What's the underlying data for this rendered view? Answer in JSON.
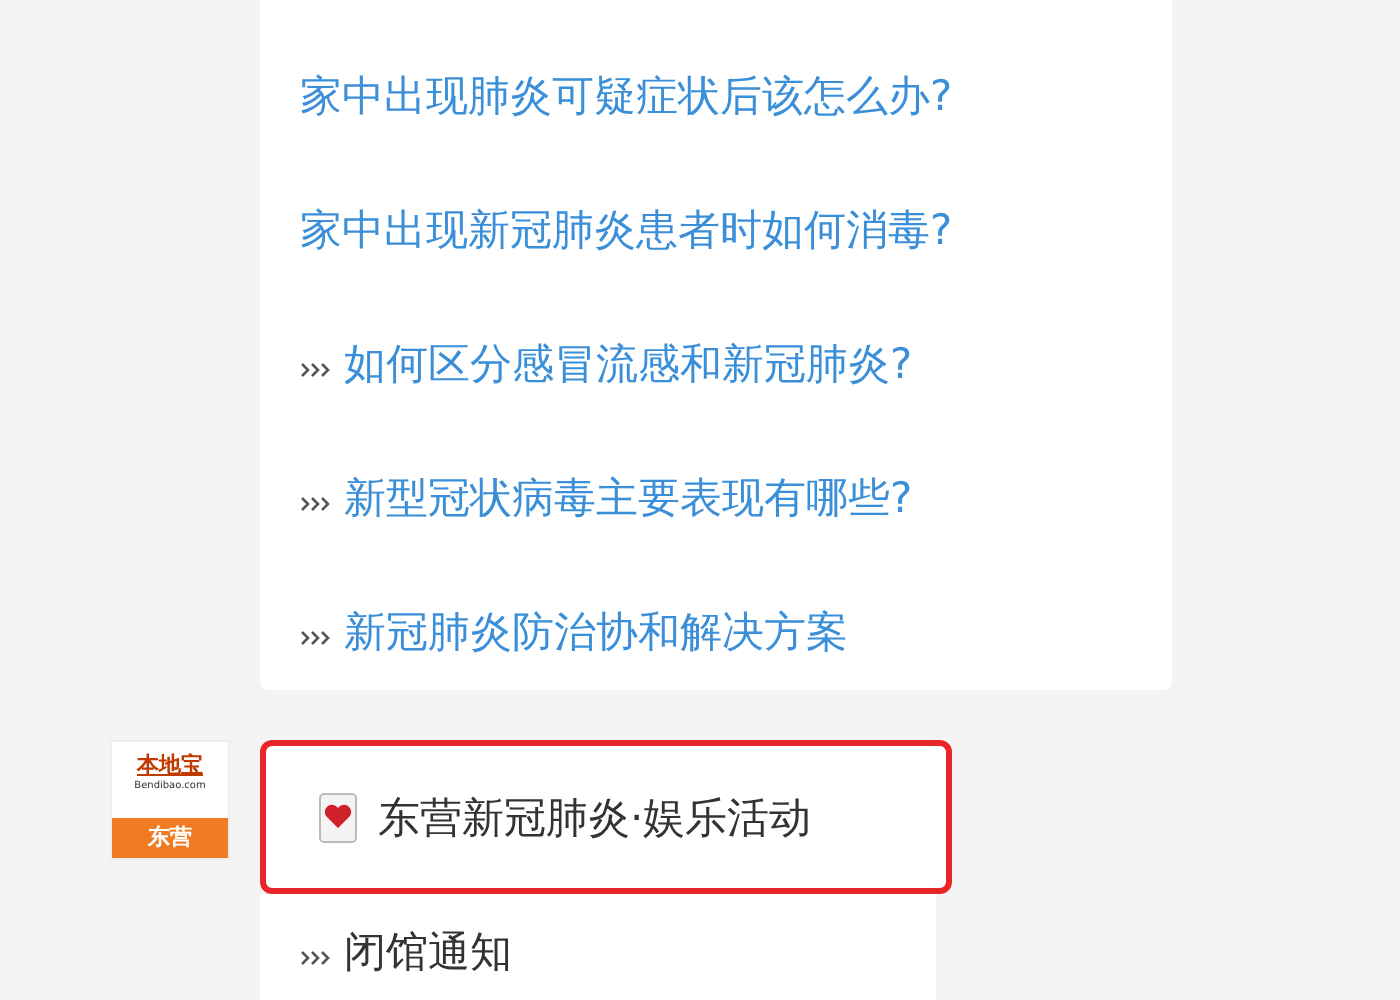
{
  "links": [
    {
      "kind": "plain",
      "text": "家中出现肺炎可疑症状后该怎么办?"
    },
    {
      "kind": "plain",
      "text": "家中出现新冠肺炎患者时如何消毒?"
    },
    {
      "kind": "arrowed",
      "text": "如何区分感冒流感和新冠肺炎?"
    },
    {
      "kind": "arrowed",
      "text": "新型冠状病毒主要表现有哪些?"
    },
    {
      "kind": "arrowed",
      "text": "新冠肺炎防治协和解决方案"
    }
  ],
  "account": {
    "logo_name": "本地宝",
    "logo_domain": "Bendibao.com",
    "logo_city": "东营"
  },
  "highlight": {
    "title": "东营新冠肺炎·娱乐活动"
  },
  "notices": [
    {
      "kind": "arrowed",
      "text": "闭馆通知"
    }
  ]
}
